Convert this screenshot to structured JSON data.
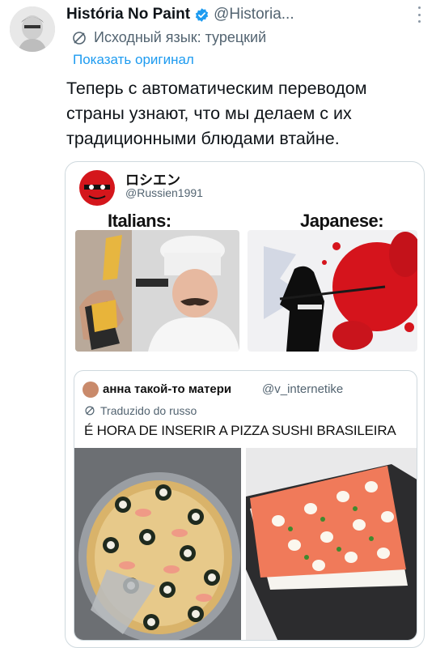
{
  "tweet": {
    "display_name": "História No Paint",
    "handle": "@Historia...",
    "translated_from": "Исходный язык: турецкий",
    "show_original": "Показать оригинал",
    "text": "Теперь с автоматическим переводом страны узнают, что мы делаем с их традиционными блюдами втайне.",
    "icons": {
      "verified": "verified-badge-icon",
      "more": "more-options-icon",
      "translate": "translate-icon"
    },
    "colors": {
      "link": "#1d9bf0",
      "verified": "#1d9bf0",
      "secondary": "#536471"
    }
  },
  "meme": {
    "author_name": "ロシエン",
    "author_handle": "@Russien1991",
    "label_left": "Italians:",
    "label_right": "Japanese:"
  },
  "quote": {
    "author_name": "анна такой-то матери",
    "author_handle": "@v_internetike",
    "translated_from": "Traduzido do russo",
    "text": "É HORA DE INSERIR A PIZZA SUSHI BRASILEIRA"
  }
}
